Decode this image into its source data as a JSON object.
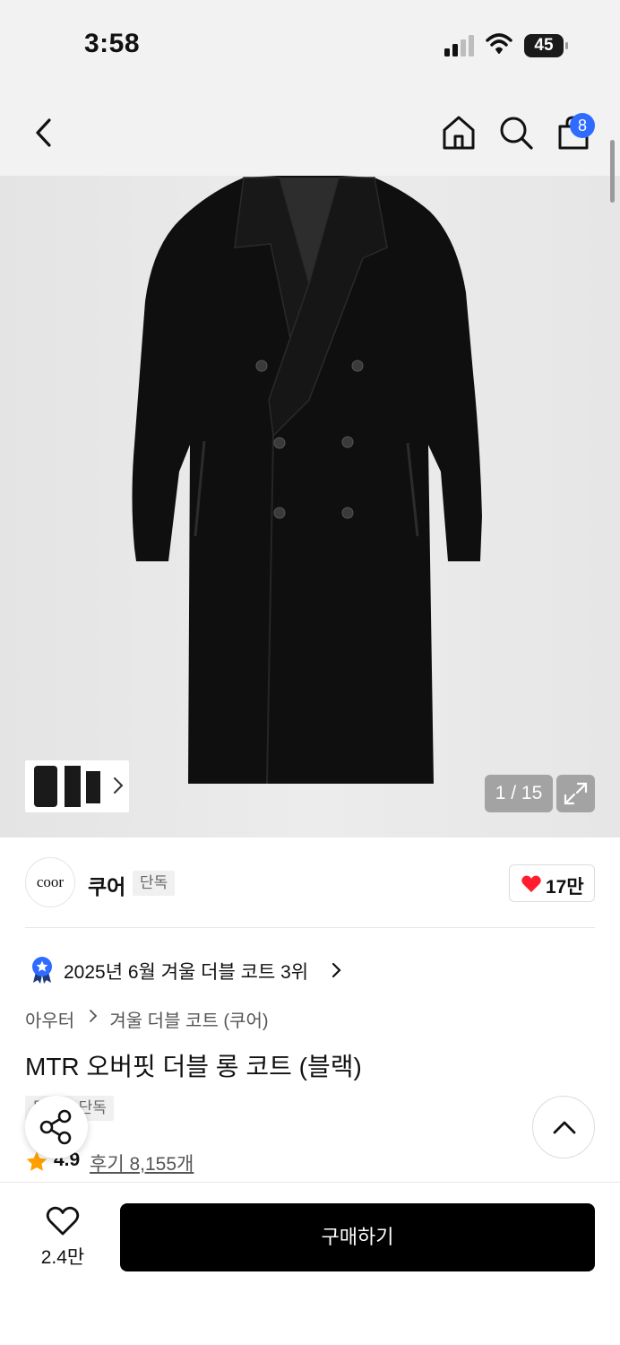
{
  "status_bar": {
    "time": "3:58",
    "battery": "45"
  },
  "nav": {
    "icons": [
      "back-arrow-icon",
      "home-icon",
      "search-icon",
      "shopping-bag-icon"
    ],
    "cart_badge": "8"
  },
  "gallery": {
    "counter": "1 / 15",
    "icons": [
      "chevron-right-icon",
      "expand-icon"
    ]
  },
  "brand": {
    "logo_text": "coor",
    "name": "쿠어",
    "tag": "단독",
    "like_count": "17만"
  },
  "ranking": {
    "text": "2025년 6월 겨울 더블 코트 3위"
  },
  "breadcrumb": {
    "category": "아우터",
    "subcategory": "겨울 더블 코트 (쿠어)"
  },
  "product": {
    "title": "MTR 오버핏 더블 롱 코트 (블랙)",
    "tag": "무신사 단독",
    "rating": "4.9",
    "reviews": "후기 8,155개"
  },
  "bottom": {
    "wish_count": "2.4만",
    "buy_label": "구매하기"
  },
  "colors": {
    "accent": "#2f6bff",
    "heart": "#ff1e2d",
    "star": "#ff9f00",
    "buy": "#000000"
  }
}
